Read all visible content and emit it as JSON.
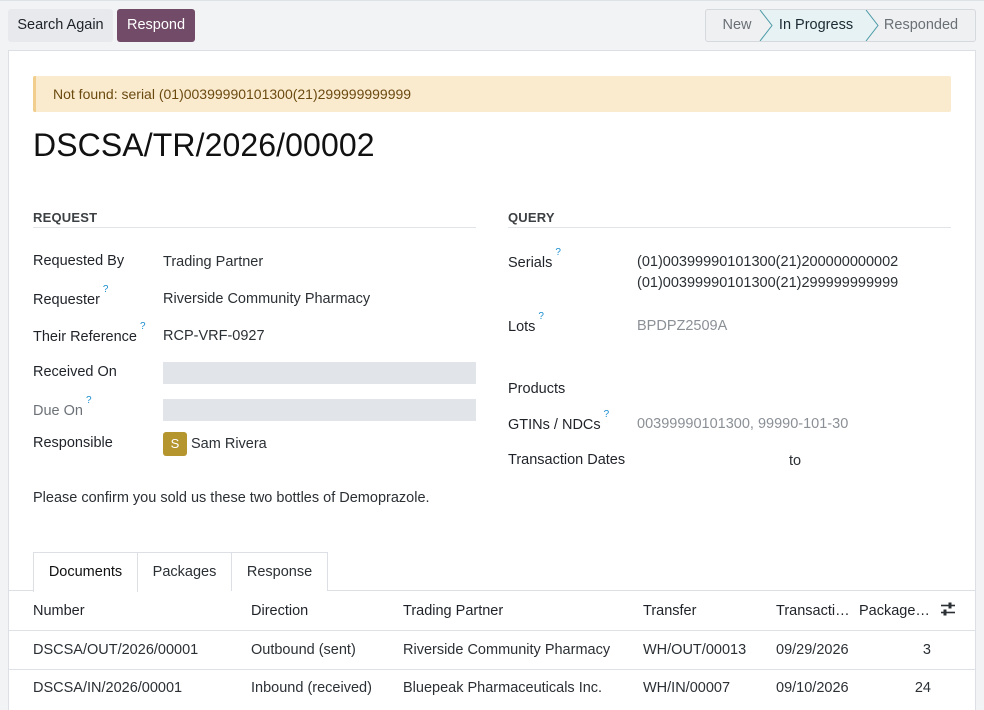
{
  "control_panel": {
    "search_again_label": "Search Again",
    "respond_label": "Respond",
    "stages": [
      {
        "label": "New",
        "state": "done"
      },
      {
        "label": "In Progress",
        "state": "current"
      },
      {
        "label": "Responded",
        "state": "todo"
      }
    ]
  },
  "alert": {
    "text": "Not found: serial (01)00399990101300(21)299999999999"
  },
  "record": {
    "title": "DSCSA/TR/2026/00002"
  },
  "request": {
    "heading": "REQUEST",
    "requested_by_label": "Requested By",
    "requested_by": "Trading Partner",
    "requester_label": "Requester",
    "requester": "Riverside Community Pharmacy",
    "their_reference_label": "Their Reference",
    "their_reference": "RCP-VRF-0927",
    "received_on_label": "Received On",
    "due_on_label": "Due On",
    "responsible_label": "Responsible",
    "responsible_initial": "S",
    "responsible": "Sam Rivera",
    "help_marker": "?"
  },
  "query": {
    "heading": "QUERY",
    "serials_label": "Serials",
    "serials": [
      "(01)00399990101300(21)200000000002",
      "(01)00399990101300(21)299999999999"
    ],
    "lots_label": "Lots",
    "lots": "BPDPZ2509A",
    "products_label": "Products",
    "gtins_label": "GTINs / NDCs",
    "gtins": "00399990101300, 99990-101-30",
    "dates_label": "Transaction Dates",
    "dates_to": "to"
  },
  "note": "Please confirm you sold us these two bottles of Demoprazole.",
  "tabs": [
    {
      "label": "Documents",
      "active": true
    },
    {
      "label": "Packages",
      "active": false
    },
    {
      "label": "Response",
      "active": false
    }
  ],
  "table": {
    "headers": [
      "Number",
      "Direction",
      "Trading Partner",
      "Transfer",
      "Transacti…",
      "Package…"
    ],
    "rows": [
      [
        "DSCSA/OUT/2026/00001",
        "Outbound (sent)",
        "Riverside Community Pharmacy",
        "WH/OUT/00013",
        "09/29/2026",
        "3"
      ],
      [
        "DSCSA/IN/2026/00001",
        "Inbound (received)",
        "Bluepeak Pharmaceuticals Inc.",
        "WH/IN/00007",
        "09/10/2026",
        "24"
      ]
    ]
  },
  "colors": {
    "primary": "#714b67",
    "alert_bg": "#faebcf",
    "avatar": "#b5952d"
  }
}
